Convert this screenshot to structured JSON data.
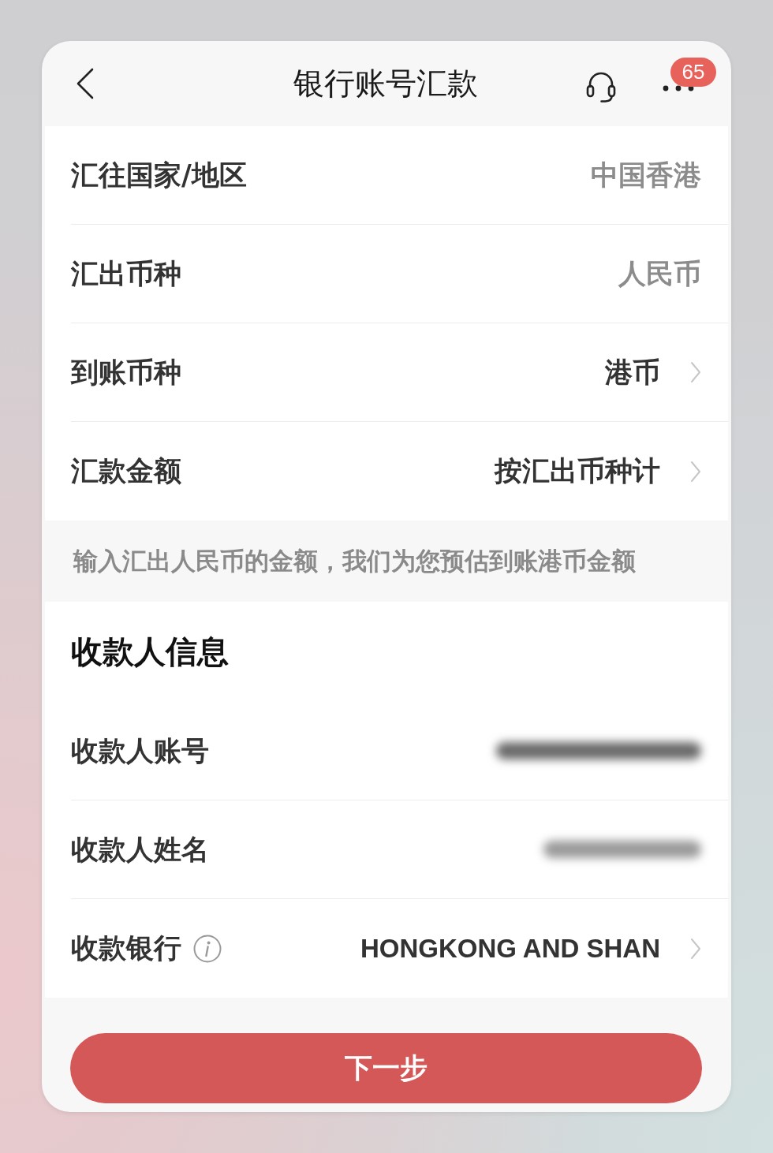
{
  "header": {
    "title": "银行账号汇款",
    "badge": "65"
  },
  "transfer_fields": [
    {
      "label": "汇往国家/地区",
      "value": "中国香港",
      "kind": "static"
    },
    {
      "label": "汇出币种",
      "value": "人民币",
      "kind": "static"
    },
    {
      "label": "到账币种",
      "value": "港币",
      "kind": "picker"
    },
    {
      "label": "汇款金额",
      "value": "按汇出币种计",
      "kind": "picker"
    }
  ],
  "hint": "输入汇出人民币的金额，我们为您预估到账港币金额",
  "payee_section": {
    "title": "收款人信息",
    "fields": [
      {
        "label": "收款人账号",
        "kind": "blurred",
        "info": false
      },
      {
        "label": "收款人姓名",
        "kind": "blurred",
        "info": false
      },
      {
        "label": "收款银行",
        "value": "HONGKONG AND SHAN",
        "kind": "picker",
        "info": true
      }
    ]
  },
  "next_button": "下一步"
}
